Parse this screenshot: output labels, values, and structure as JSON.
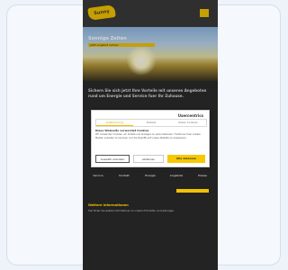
{
  "header": {
    "logo_text": "Sunny"
  },
  "hero": {
    "title": "Sonnige Zeiten",
    "tag": "Jetzt Angebot sichern"
  },
  "section": {
    "text": "Sichern Sie sich jetzt Ihre Vorteile mit unseren Angeboten rund um Energie und Service fuer Ihr Zuhause."
  },
  "consent": {
    "brand": "Usercentrics",
    "tabs": [
      "Zustimmung",
      "Details",
      "Ueber Cookies"
    ],
    "heading": "Diese Webseite verwendet Cookies",
    "body": "Wir verwenden Cookies, um Inhalte und Anzeigen zu personalisieren, Funktionen fuer soziale Medien anbieten zu koennen und die Zugriffe auf unsere Website zu analysieren.",
    "buttons": [
      "Auswahl erlauben",
      "Ablehnen",
      "Alle zulassen"
    ]
  },
  "info_row": [
    "Service",
    "Kontakt",
    "Energie",
    "Angebote",
    "Presse"
  ],
  "section2": {
    "heading": "Weitere Informationen",
    "text": "Hier finden Sie weitere Informationen zu unseren Produkten und Leistungen."
  }
}
